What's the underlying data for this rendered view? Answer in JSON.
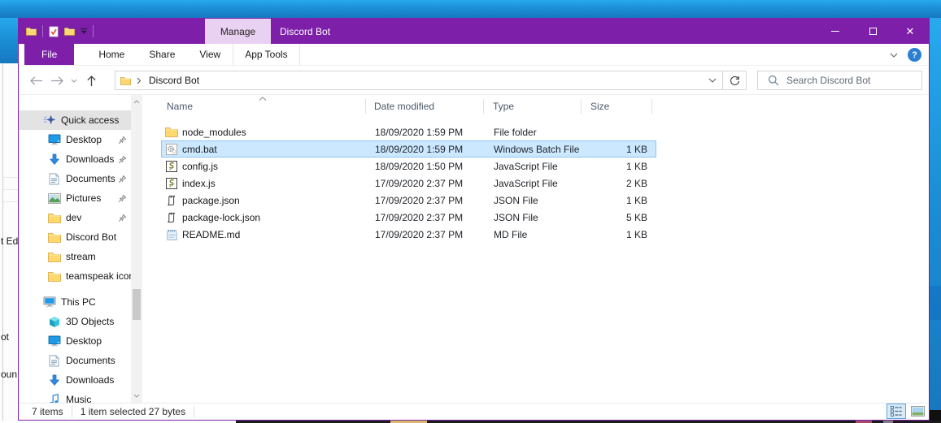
{
  "window": {
    "title": "Discord Bot",
    "contextual_tab_label": "Manage"
  },
  "ribbon": {
    "tabs": [
      "File",
      "Home",
      "Share",
      "View",
      "App Tools"
    ],
    "active_tab": "File",
    "contextual_tab": "App Tools"
  },
  "address_bar": {
    "path": "Discord Bot",
    "search_placeholder": "Search Discord Bot"
  },
  "sidebar": {
    "items": [
      {
        "label": "Quick access",
        "icon": "quick-access-star",
        "level": 0,
        "selected": true
      },
      {
        "label": "Desktop",
        "icon": "desktop",
        "level": 1,
        "pinned": true
      },
      {
        "label": "Downloads",
        "icon": "downloads",
        "level": 1,
        "pinned": true
      },
      {
        "label": "Documents",
        "icon": "documents",
        "level": 1,
        "pinned": true
      },
      {
        "label": "Pictures",
        "icon": "pictures",
        "level": 1,
        "pinned": true
      },
      {
        "label": "dev",
        "icon": "folder",
        "level": 1,
        "pinned": true
      },
      {
        "label": "Discord Bot",
        "icon": "folder",
        "level": 1
      },
      {
        "label": "stream",
        "icon": "folder",
        "level": 1
      },
      {
        "label": "teamspeak icons",
        "icon": "folder",
        "level": 1
      },
      {
        "label": "This PC",
        "icon": "this-pc",
        "level": 0,
        "section_gap": true
      },
      {
        "label": "3D Objects",
        "icon": "3d-objects",
        "level": 1
      },
      {
        "label": "Desktop",
        "icon": "desktop",
        "level": 1
      },
      {
        "label": "Documents",
        "icon": "documents",
        "level": 1
      },
      {
        "label": "Downloads",
        "icon": "downloads",
        "level": 1
      },
      {
        "label": "Music",
        "icon": "music",
        "level": 1
      }
    ]
  },
  "file_list": {
    "columns": [
      "Name",
      "Date modified",
      "Type",
      "Size"
    ],
    "sort": {
      "column": "Name",
      "direction": "ascending"
    },
    "rows": [
      {
        "name": "node_modules",
        "icon": "folder",
        "date_modified": "18/09/2020 1:59 PM",
        "type": "File folder",
        "size": ""
      },
      {
        "name": "cmd.bat",
        "icon": "batch-file",
        "date_modified": "18/09/2020 1:59 PM",
        "type": "Windows Batch File",
        "size": "1 KB",
        "selected": true
      },
      {
        "name": "config.js",
        "icon": "js-file",
        "date_modified": "18/09/2020 1:50 PM",
        "type": "JavaScript File",
        "size": "1 KB"
      },
      {
        "name": "index.js",
        "icon": "js-file",
        "date_modified": "17/09/2020 2:37 PM",
        "type": "JavaScript File",
        "size": "2 KB"
      },
      {
        "name": "package.json",
        "icon": "json-file",
        "date_modified": "17/09/2020 2:37 PM",
        "type": "JSON File",
        "size": "1 KB"
      },
      {
        "name": "package-lock.json",
        "icon": "json-file",
        "date_modified": "17/09/2020 2:37 PM",
        "type": "JSON File",
        "size": "5 KB"
      },
      {
        "name": "README.md",
        "icon": "md-file",
        "date_modified": "17/09/2020 2:37 PM",
        "type": "MD File",
        "size": "1 KB"
      }
    ]
  },
  "status_bar": {
    "items_count": "7 items",
    "selection_info": "1 item selected 27 bytes",
    "view_modes": [
      "details-view",
      "thumbnails-view"
    ],
    "active_view": "details-view"
  },
  "quick_access_toolbar": {
    "icons": [
      "folder",
      "properties-check",
      "folder",
      "qat-dropdown"
    ]
  },
  "background_window_fragments": [
    "t Edg",
    "ot",
    "oun"
  ],
  "colors": {
    "titlebar": "#7d1fa8",
    "contextual_tab_bg": "#e9d1f2",
    "selection_bg": "#cce8ff",
    "selection_border": "#8fc5ef",
    "desktop_blue": "#1b8fd6",
    "accent_help": "#2a7fd4",
    "folder_yellow": "#ffd96d"
  }
}
